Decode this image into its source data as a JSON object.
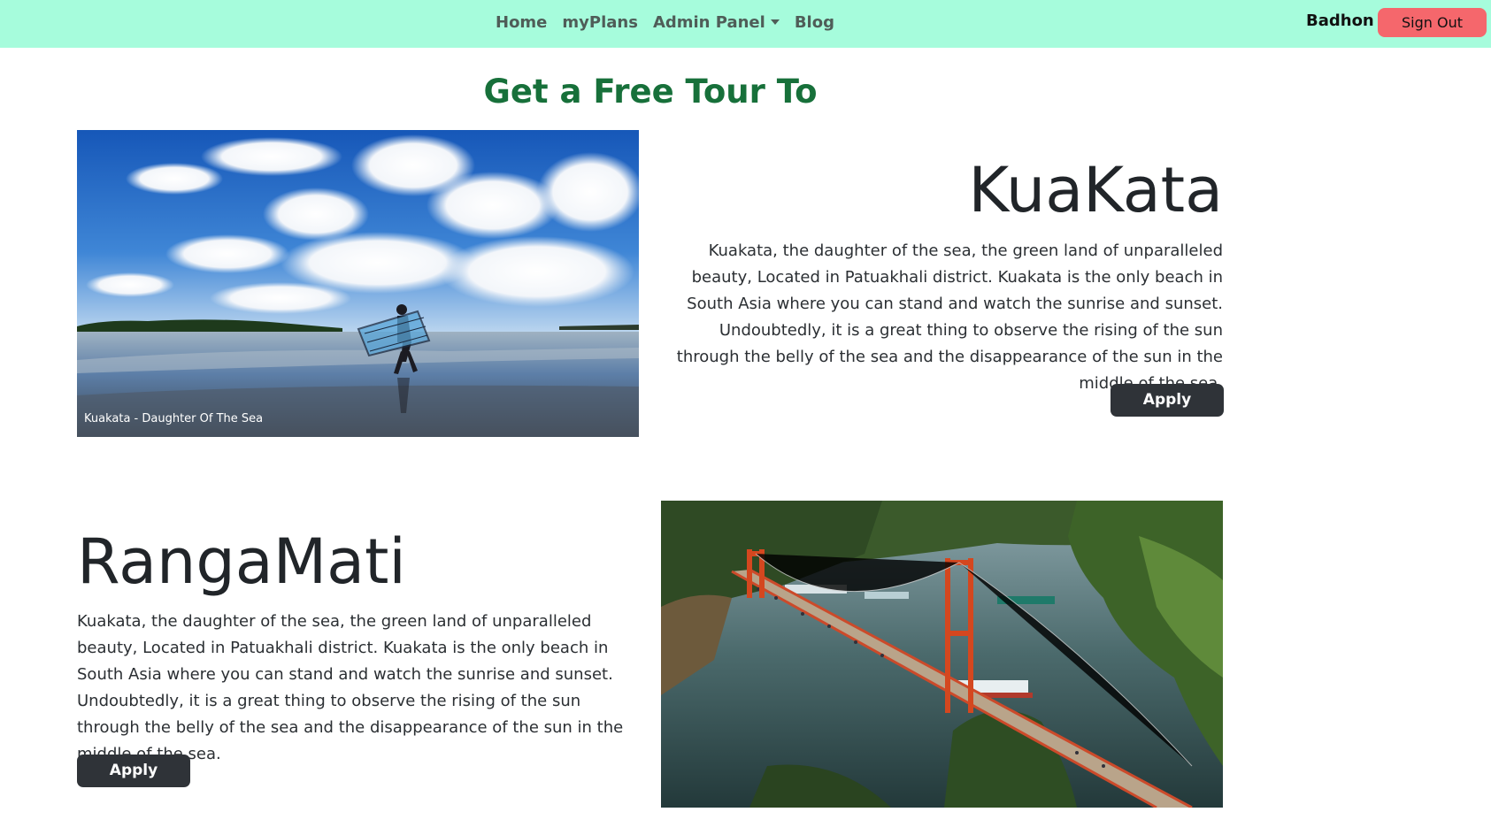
{
  "navbar": {
    "links": [
      {
        "label": "Home"
      },
      {
        "label": "myPlans"
      },
      {
        "label": "Admin Panel"
      },
      {
        "label": "Blog"
      }
    ],
    "user_name": "Badhon",
    "signout_label": "Sign Out",
    "background_color": "#a6fcdc",
    "signout_color": "#f5676c"
  },
  "heading": {
    "text": "Get a Free Tour To",
    "color": "#17703a"
  },
  "tours": [
    {
      "title": "KuaKata",
      "description": "Kuakata, the daughter of the sea, the green land of unparalleled beauty, Located in Patuakhali district. Kuakata is the only beach in South Asia where you can stand and watch the sunrise and sunset. Undoubtedly, it is a great thing to observe the rising of the sun through the belly of the sea and the disappearance of the sun in the middle of the sea.",
      "apply_label": "Apply",
      "image_caption": "Kuakata - Daughter Of The Sea"
    },
    {
      "title": "RangaMati",
      "description": "Kuakata, the daughter of the sea, the green land of unparalleled beauty, Located in Patuakhali district. Kuakata is the only beach in South Asia where you can stand and watch the sunrise and sunset. Undoubtedly, it is a great thing to observe the rising of the sun through the belly of the sea and the disappearance of the sun in the middle of the sea.",
      "apply_label": "Apply"
    }
  ],
  "button_color": "#2f3338"
}
